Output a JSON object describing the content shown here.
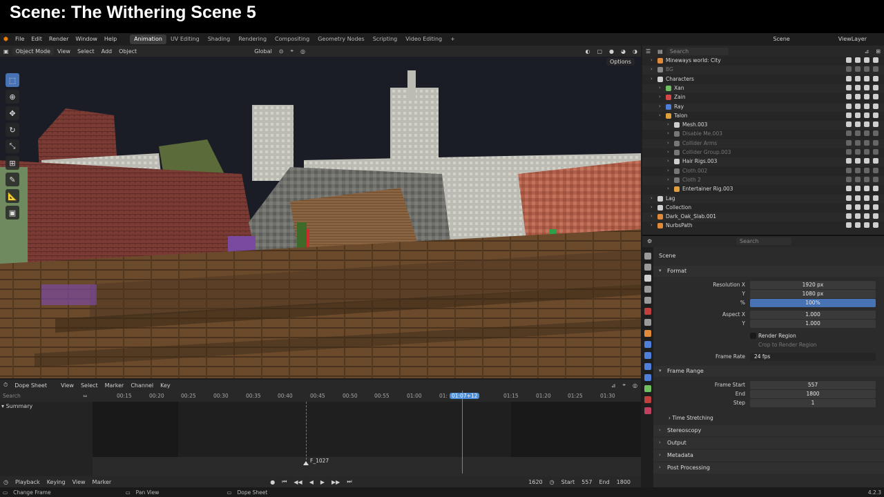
{
  "banner": {
    "title": "Scene: The Withering Scene 5"
  },
  "menubar": {
    "menus": [
      "File",
      "Edit",
      "Render",
      "Window",
      "Help"
    ],
    "workspaces": [
      "Animation",
      "UV Editing",
      "Shading",
      "Rendering",
      "Compositing",
      "Geometry Nodes",
      "Scripting",
      "Video Editing"
    ],
    "active_workspace": "Animation",
    "scene": "Scene",
    "view_layer": "ViewLayer"
  },
  "viewport": {
    "mode": "Object Mode",
    "menus": [
      "View",
      "Select",
      "Add",
      "Object"
    ],
    "transform_orientation": "Global",
    "options": "Options"
  },
  "dopesheet": {
    "editor": "Dope Sheet",
    "menus": [
      "View",
      "Select",
      "Marker",
      "Channel",
      "Key"
    ],
    "search_placeholder": "Search",
    "channel": "Summary",
    "ruler_ticks": [
      "00:15",
      "00:20",
      "00:25",
      "00:30",
      "00:35",
      "00:40",
      "00:45",
      "00:50",
      "00:55",
      "01:00",
      "01:",
      "01:15",
      "01:20",
      "01:25",
      "01:30"
    ],
    "current_time": "01:07+12",
    "marker": "F_1027"
  },
  "timeline": {
    "menus": [
      "Playback",
      "Keying",
      "View",
      "Marker"
    ],
    "current_frame": "1620",
    "start_label": "Start",
    "start": "557",
    "end_label": "End",
    "end": "1800"
  },
  "status": {
    "left": "Change Frame",
    "mid": "Pan View",
    "right": "Dope Sheet",
    "version": "4.2.3"
  },
  "outliner": {
    "search_placeholder": "Search",
    "rows": [
      {
        "label": "Mineways world: City",
        "depth": 1,
        "dim": false,
        "color": "#e08a3a"
      },
      {
        "label": "BG",
        "depth": 1,
        "dim": true,
        "color": "#8a8a8a"
      },
      {
        "label": "Characters",
        "depth": 1,
        "dim": false,
        "color": "#cfcfcf"
      },
      {
        "label": "Xan",
        "depth": 2,
        "dim": false,
        "color": "#6fbf5f"
      },
      {
        "label": "Zain",
        "depth": 2,
        "dim": false,
        "color": "#d04848"
      },
      {
        "label": "Ray",
        "depth": 2,
        "dim": false,
        "color": "#4f7fd8"
      },
      {
        "label": "Talon",
        "depth": 2,
        "dim": false,
        "color": "#e0a040"
      },
      {
        "label": "Mesh.003",
        "depth": 3,
        "dim": false,
        "color": "#cfcfcf"
      },
      {
        "label": "Disable Me.003",
        "depth": 3,
        "dim": true,
        "color": "#777"
      },
      {
        "label": "Collider Arms",
        "depth": 3,
        "dim": true,
        "color": "#777"
      },
      {
        "label": "Collider Group.003",
        "depth": 3,
        "dim": true,
        "color": "#777"
      },
      {
        "label": "Hair Rigs.003",
        "depth": 3,
        "dim": false,
        "color": "#cfcfcf"
      },
      {
        "label": "Cloth.002",
        "depth": 3,
        "dim": true,
        "color": "#777"
      },
      {
        "label": "Cloth 2",
        "depth": 3,
        "dim": true,
        "color": "#777"
      },
      {
        "label": "Entertainer Rig.003",
        "depth": 3,
        "dim": false,
        "color": "#e0a040"
      },
      {
        "label": "Lag",
        "depth": 1,
        "dim": false,
        "color": "#cfcfcf"
      },
      {
        "label": "Collection",
        "depth": 1,
        "dim": false,
        "color": "#cfcfcf"
      },
      {
        "label": "Dark_Oak_Slab.001",
        "depth": 1,
        "dim": false,
        "color": "#e08a3a"
      },
      {
        "label": "NurbsPath",
        "depth": 1,
        "dim": false,
        "color": "#e08a3a"
      }
    ]
  },
  "properties": {
    "search_placeholder": "Search",
    "context": "Scene",
    "format_section": "Format",
    "resolution_x_label": "Resolution X",
    "resolution_x": "1920 px",
    "y_label": "Y",
    "resolution_y": "1080 px",
    "percent_label": "%",
    "percent": "100%",
    "aspect_x_label": "Aspect X",
    "aspect_x": "1.000",
    "aspect_y": "1.000",
    "render_region": "Render Region",
    "crop": "Crop to Render Region",
    "frame_rate_label": "Frame Rate",
    "frame_rate": "24 fps",
    "frame_range_section": "Frame Range",
    "frame_start_label": "Frame Start",
    "frame_start": "557",
    "end_label": "End",
    "frame_end": "1800",
    "step_label": "Step",
    "step": "1",
    "time_stretching": "Time Stretching",
    "stereoscopy": "Stereoscopy",
    "output": "Output",
    "metadata": "Metadata",
    "post_processing": "Post Processing"
  }
}
